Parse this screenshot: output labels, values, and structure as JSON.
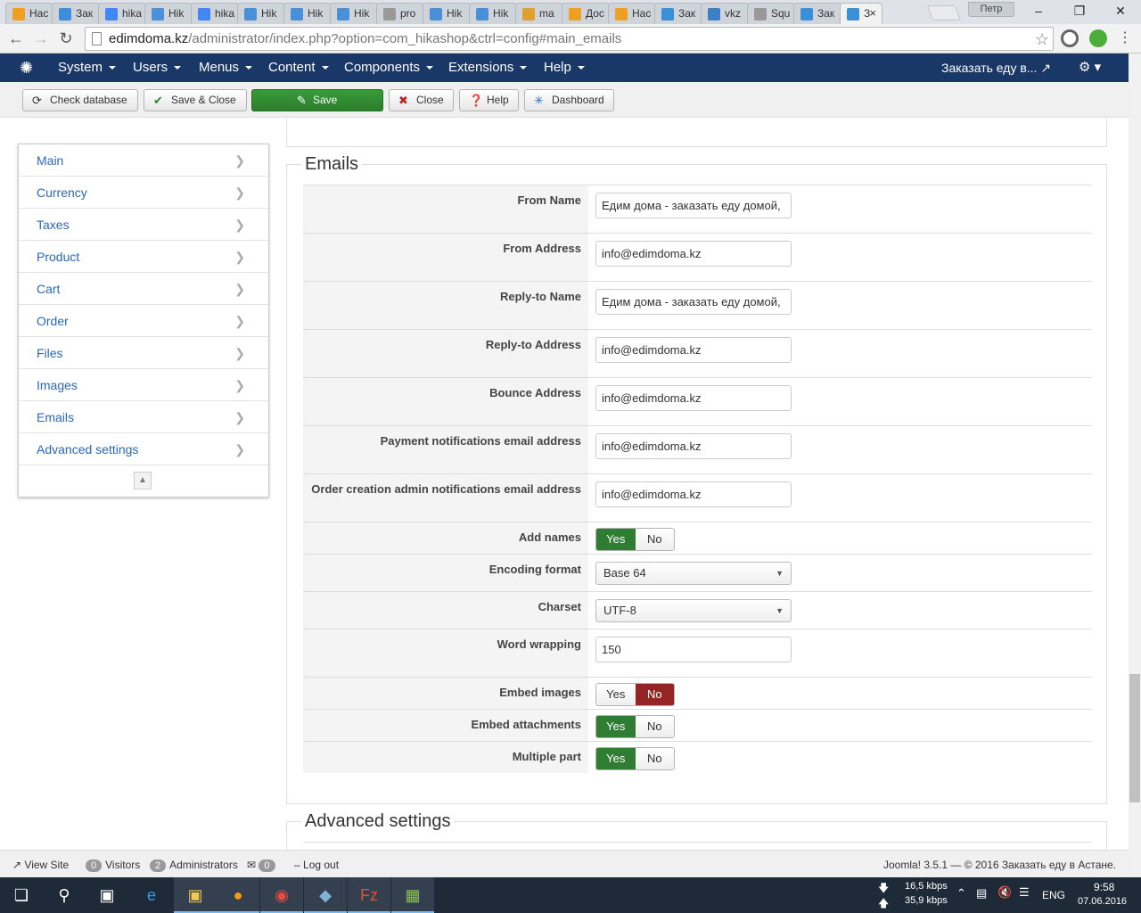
{
  "browser": {
    "tabs": [
      {
        "label": "Нас",
        "color": "#f0a020"
      },
      {
        "label": "Зак",
        "color": "#3a8fd8"
      },
      {
        "label": "hika",
        "color": "#4285f4"
      },
      {
        "label": "Hik",
        "color": "#4a90d9"
      },
      {
        "label": "hika",
        "color": "#4285f4"
      },
      {
        "label": "Hik",
        "color": "#4a90d9"
      },
      {
        "label": "Hik",
        "color": "#4a90d9"
      },
      {
        "label": "Hik",
        "color": "#4a90d9"
      },
      {
        "label": "pro",
        "color": "#999999"
      },
      {
        "label": "Hik",
        "color": "#4a90d9"
      },
      {
        "label": "Hik",
        "color": "#4a90d9"
      },
      {
        "label": "ma",
        "color": "#e0a030"
      },
      {
        "label": "Дос",
        "color": "#f0a020"
      },
      {
        "label": "Нас",
        "color": "#f0a020"
      },
      {
        "label": "Зак",
        "color": "#3a8fd8"
      },
      {
        "label": "vkz",
        "color": "#3a7fc8"
      },
      {
        "label": "Squ",
        "color": "#999999"
      },
      {
        "label": "Зак",
        "color": "#3a8fd8"
      },
      {
        "label": "З",
        "color": "#3a8fd8"
      }
    ],
    "user": "Петр",
    "url_domain": "edimdoma.kz",
    "url_path": "/administrator/index.php?option=com_hikashop&ctrl=config#main_emails"
  },
  "joomla_nav": {
    "menus": [
      "System",
      "Users",
      "Menus",
      "Content",
      "Components",
      "Extensions",
      "Help"
    ],
    "site_link": "Заказать еду в..."
  },
  "toolbar": {
    "check_database": "Check database",
    "save_close": "Save & Close",
    "save": "Save",
    "close": "Close",
    "help": "Help",
    "dashboard": "Dashboard"
  },
  "sidebar": {
    "items": [
      "Main",
      "Currency",
      "Taxes",
      "Product",
      "Cart",
      "Order",
      "Files",
      "Images",
      "Emails",
      "Advanced settings"
    ]
  },
  "emails": {
    "legend": "Emails",
    "from_name": {
      "label": "From Name",
      "value": "Едим дома - заказать еду домой,"
    },
    "from_address": {
      "label": "From Address",
      "value": "info@edimdoma.kz"
    },
    "reply_name": {
      "label": "Reply-to Name",
      "value": "Едим дома - заказать еду домой,"
    },
    "reply_address": {
      "label": "Reply-to Address",
      "value": "info@edimdoma.kz"
    },
    "bounce_address": {
      "label": "Bounce Address",
      "value": "info@edimdoma.kz"
    },
    "payment_notif": {
      "label": "Payment notifications email address",
      "value": "info@edimdoma.kz"
    },
    "order_notif": {
      "label": "Order creation admin notifications email address",
      "value": "info@edimdoma.kz"
    },
    "add_names": {
      "label": "Add names",
      "value": "Yes"
    },
    "encoding": {
      "label": "Encoding format",
      "value": "Base 64"
    },
    "charset": {
      "label": "Charset",
      "value": "UTF-8"
    },
    "word_wrap": {
      "label": "Word wrapping",
      "value": "150"
    },
    "embed_images": {
      "label": "Embed images",
      "value": "No"
    },
    "embed_attachments": {
      "label": "Embed attachments",
      "value": "Yes"
    },
    "multiple_part": {
      "label": "Multiple part",
      "value": "Yes"
    },
    "yes": "Yes",
    "no": "No"
  },
  "advanced": {
    "legend": "Advanced settings"
  },
  "statusbar": {
    "view_site": "View Site",
    "visitors_count": "0",
    "visitors": "Visitors",
    "admins_count": "2",
    "admins": "Administrators",
    "messages_count": "0",
    "logout": "Log out",
    "copyright": "Joomla! 3.5.1 — © 2016 Заказать еду в Астане."
  },
  "taskbar": {
    "net_down": "16,5 kbps",
    "net_up": "35,9 kbps",
    "lang": "ENG",
    "time": "9:58",
    "date": "07.06.2016"
  }
}
